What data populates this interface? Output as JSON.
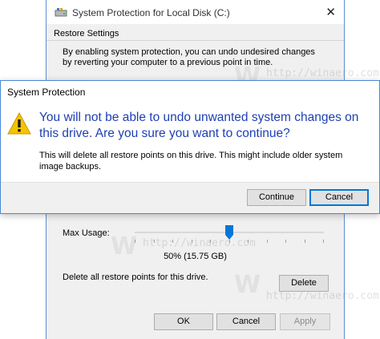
{
  "background_window": {
    "title": "System Protection for Local Disk (C:)",
    "close_glyph": "✕",
    "section_title": "Restore Settings",
    "description": "By enabling system protection, you can undo undesired changes by reverting your computer to a previous point in time.",
    "max_usage_label": "Max Usage:",
    "usage_value": "50% (15.75 GB)",
    "usage_fraction": 0.5,
    "delete_label": "Delete all restore points for this drive.",
    "buttons": {
      "delete": "Delete",
      "ok": "OK",
      "cancel": "Cancel",
      "apply": "Apply"
    }
  },
  "dialog": {
    "title": "System Protection",
    "heading": "You will not be able to undo unwanted system changes on this drive. Are you sure you want to continue?",
    "body": "This will delete all restore points on this drive. This might include older system image backups.",
    "buttons": {
      "continue": "Continue",
      "cancel": "Cancel"
    }
  },
  "watermark": {
    "logo": "W",
    "text": "http://winaero.com"
  },
  "colors": {
    "accent": "#0078d7",
    "heading": "#1f3fb3",
    "slider_thumb": "#0078d7",
    "warning_yellow": "#f5c400"
  },
  "icons": {
    "title_icon": "drive-icon",
    "dialog_icon": "warning-icon",
    "close": "close-icon"
  }
}
